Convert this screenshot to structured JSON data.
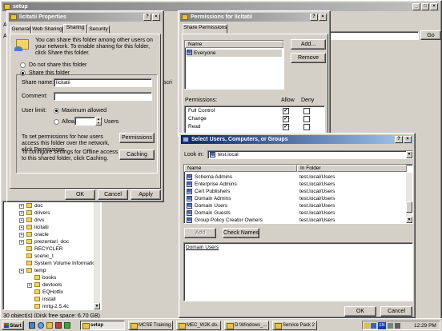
{
  "explorer": {
    "title": "setup",
    "menu_a": "A",
    "menu_a2": "A",
    "scri": "scri",
    "go": "Go",
    "status": "30 object(s) (Disk free space: 6.70 GB)",
    "tree": [
      {
        "label": "doc",
        "expand": true
      },
      {
        "label": "drivers",
        "expand": true
      },
      {
        "label": "drvs",
        "expand": true
      },
      {
        "label": "licitatii",
        "expand": true
      },
      {
        "label": "oracle",
        "expand": true
      },
      {
        "label": "prezentari_doc",
        "expand": true
      },
      {
        "label": "RECYCLER",
        "expand": false
      },
      {
        "label": "scenic_t",
        "expand": false
      },
      {
        "label": "System Volume Information",
        "expand": false
      },
      {
        "label": "temp",
        "expand": true
      },
      {
        "label": "books",
        "expand": false
      },
      {
        "label": "devtools",
        "expand": true
      },
      {
        "label": "EQHotfix",
        "expand": false
      },
      {
        "label": "install",
        "expand": false
      },
      {
        "label": "mrtg-2.5.4c",
        "expand": false
      }
    ]
  },
  "properties": {
    "title": "licitatii Properties",
    "tabs": [
      "General",
      "Web Sharing",
      "Sharing",
      "Security"
    ],
    "selected_tab": "Sharing",
    "intro": "You can share this folder among other users on your network. To enable sharing for this folder, click Share this folder.",
    "opt_not_share": "Do not share this folder",
    "opt_share": "Share this folder",
    "share_name_label": "Share name:",
    "share_name_value": "licitatii",
    "comment_label": "Comment:",
    "comment_value": "",
    "user_limit_label": "User limit:",
    "max_allowed": "Maximum allowed",
    "allow": "Allow",
    "users": "Users",
    "perm_text": "To set permissions for how users access this folder over the network, click Permissions.",
    "perm_btn": "Permissions",
    "cache_text": "To configure settings for Offline access to this shared folder, click Caching.",
    "cache_btn": "Caching",
    "ok": "OK",
    "cancel": "Cancel",
    "apply": "Apply"
  },
  "permissions": {
    "title": "Permissions for licitatii",
    "tab": "Share Permissions",
    "name_header": "Name",
    "entry": "Everyone",
    "add": "Add...",
    "remove": "Remove",
    "perm_label": "Permissions:",
    "allow": "Allow",
    "deny": "Deny",
    "rows": [
      {
        "name": "Full Control",
        "allow": true,
        "deny": false
      },
      {
        "name": "Change",
        "allow": true,
        "deny": false
      },
      {
        "name": "Read",
        "allow": true,
        "deny": false
      }
    ]
  },
  "select": {
    "title": "Select Users, Computers, or Groups",
    "look_in_label": "Look in:",
    "look_in_value": "test.local",
    "col_name": "Name",
    "col_folder": "In Folder",
    "rows": [
      {
        "name": "Schema Admins",
        "folder": "test.local/Users"
      },
      {
        "name": "Enterprise Admins",
        "folder": "test.local/Users"
      },
      {
        "name": "Cert Publishers",
        "folder": "test.local/Users"
      },
      {
        "name": "Domain Admins",
        "folder": "test.local/Users"
      },
      {
        "name": "Domain Users",
        "folder": "test.local/Users"
      },
      {
        "name": "Domain Guests",
        "folder": "test.local/Users"
      },
      {
        "name": "Group Policy Creator Owners",
        "folder": "test.local/Users"
      }
    ],
    "add": "Add",
    "check_names": "Check Names",
    "selected_text": "Domain Users",
    "ok": "OK",
    "cancel": "Cancel"
  },
  "taskbar": {
    "start": "Start",
    "tasks": [
      "setup",
      "MCSE Training...",
      "MEC_W2K.do...",
      "D:\\Windows_...",
      "Service Pack 2"
    ],
    "clock": "12:29 PM",
    "lang": "EN"
  }
}
